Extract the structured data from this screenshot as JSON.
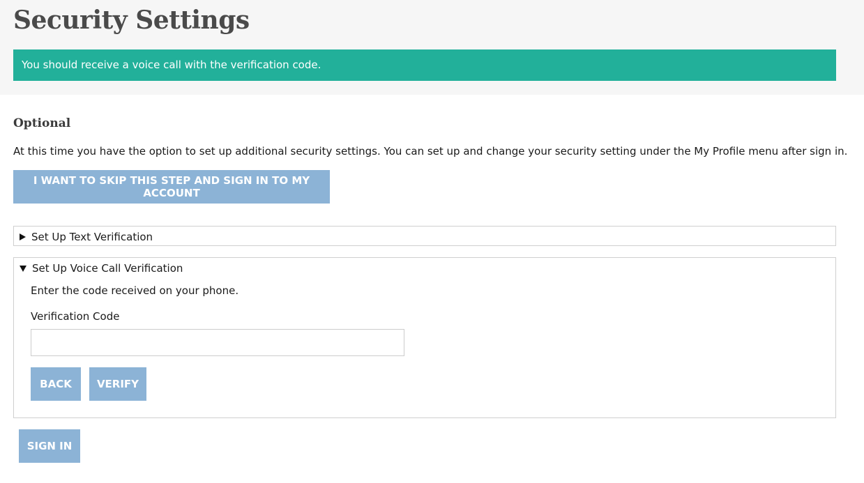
{
  "header": {
    "title": "Security Settings",
    "alert": "You should receive a voice call with the verification code."
  },
  "optional": {
    "title": "Optional",
    "intro": "At this time you have the option to set up additional security settings. You can set up and change your security setting under the My Profile menu after sign in.",
    "skip_label": "I WANT TO SKIP THIS STEP AND SIGN IN TO MY ACCOUNT"
  },
  "text_verification": {
    "summary": "Set Up Text Verification",
    "expanded": false
  },
  "voice_verification": {
    "summary": "Set Up Voice Call Verification",
    "expanded": true,
    "instruction": "Enter the code received on your phone.",
    "code_label": "Verification Code",
    "code_value": "",
    "back_label": "BACK",
    "verify_label": "VERIFY"
  },
  "footer": {
    "signin_label": "SIGN IN"
  },
  "colors": {
    "alert_bg": "#22b09a",
    "button_bg": "#8cb3d6",
    "header_bg": "#f6f6f6"
  },
  "icons": {
    "collapsed": "triangle-right-icon",
    "expanded": "triangle-down-icon"
  }
}
